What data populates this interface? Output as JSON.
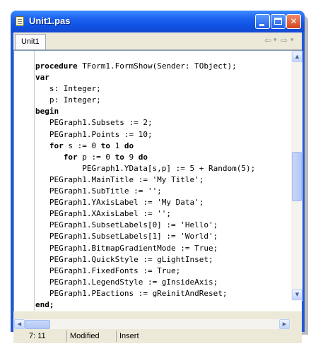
{
  "window": {
    "title": "Unit1.pas",
    "minimize_label": "",
    "maximize_label": "",
    "close_label": "✕"
  },
  "tabs": [
    {
      "label": "Unit1"
    }
  ],
  "nav": {
    "back_glyph": "⇦",
    "back_dropdown_glyph": "▾",
    "forward_glyph": "⇨",
    "forward_dropdown_glyph": "▾"
  },
  "code": {
    "lines": [
      [
        {
          "t": "procedure",
          "kw": true
        },
        {
          "t": " TForm1.FormShow(Sender: TObject);"
        }
      ],
      [
        {
          "t": "var",
          "kw": true
        }
      ],
      [
        {
          "t": "   s: Integer;"
        }
      ],
      [
        {
          "t": "   p: Integer;"
        }
      ],
      [
        {
          "t": "begin",
          "kw": true
        }
      ],
      [
        {
          "t": "   PEGraph1.Subsets := 2;"
        }
      ],
      [
        {
          "t": "   PEGraph1.Points := 10;"
        }
      ],
      [
        {
          "t": "   "
        },
        {
          "t": "for",
          "kw": true
        },
        {
          "t": " s := 0 "
        },
        {
          "t": "to",
          "kw": true
        },
        {
          "t": " 1 "
        },
        {
          "t": "do",
          "kw": true
        }
      ],
      [
        {
          "t": "      "
        },
        {
          "t": "for",
          "kw": true
        },
        {
          "t": " p := 0 "
        },
        {
          "t": "to",
          "kw": true
        },
        {
          "t": " 9 "
        },
        {
          "t": "do",
          "kw": true
        }
      ],
      [
        {
          "t": "          PEGraph1.YData[s,p] := 5 + Random(5);"
        }
      ],
      [
        {
          "t": "   PEGraph1.MainTitle := 'My Title';"
        }
      ],
      [
        {
          "t": "   PEGraph1.SubTitle := '';"
        }
      ],
      [
        {
          "t": "   PEGraph1.YAxisLabel := 'My Data';"
        }
      ],
      [
        {
          "t": "   PEGraph1.XAxisLabel := '';"
        }
      ],
      [
        {
          "t": "   PEGraph1.SubsetLabels[0] := 'Hello';"
        }
      ],
      [
        {
          "t": "   PEGraph1.SubsetLabels[1] := 'World';"
        }
      ],
      [
        {
          "t": "   PEGraph1.BitmapGradientMode := True;"
        }
      ],
      [
        {
          "t": "   PEGraph1.QuickStyle := gLightInset;"
        }
      ],
      [
        {
          "t": "   PEGraph1.FixedFonts := True;"
        }
      ],
      [
        {
          "t": "   PEGraph1.LegendStyle := gInsideAxis;"
        }
      ],
      [
        {
          "t": "   PEGraph1.PEactions := gReinitAndReset;"
        }
      ],
      [
        {
          "t": "end;",
          "kw": true
        }
      ]
    ]
  },
  "scroll": {
    "up_glyph": "▲",
    "down_glyph": "▼",
    "left_glyph": "◀",
    "right_glyph": "▶"
  },
  "status": {
    "position": "7:  11",
    "modified": "Modified",
    "mode": "Insert"
  },
  "colors": {
    "titlebar": "#0f52e3",
    "editor_bg": "#ffffff",
    "chrome": "#ece9d8"
  }
}
